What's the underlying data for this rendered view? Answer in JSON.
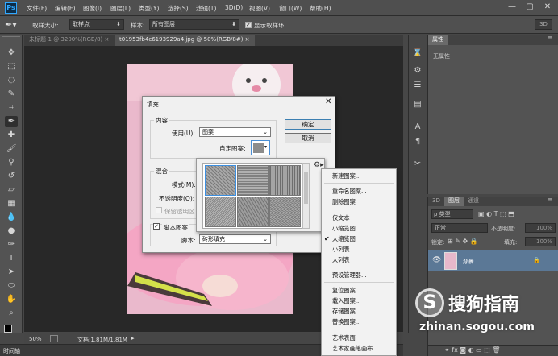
{
  "menubar": {
    "logo": "Ps",
    "items": [
      "文件(F)",
      "编辑(E)",
      "图像(I)",
      "图层(L)",
      "类型(Y)",
      "选择(S)",
      "滤镜(T)",
      "3D(D)",
      "视图(V)",
      "窗口(W)",
      "帮助(H)"
    ],
    "win_min": "—",
    "win_max": "▢",
    "win_close": "✕"
  },
  "options": {
    "sample_size_label": "取样大小:",
    "sample_size_value": "取样点",
    "sample_label": "样本:",
    "sample_value": "所有图层",
    "show_ring_label": "显示取样环",
    "mode_3d": "3D"
  },
  "tabs": [
    {
      "label": "未标题-1 @ 3200%(RGB/8) ×"
    },
    {
      "label": "t01953fb4c6193929a4.jpg @ 50%(RGB/8#) ×"
    }
  ],
  "status": {
    "zoom": "50%",
    "doc": "文档:1.81M/1.81M"
  },
  "timeline": "时间轴",
  "properties": {
    "tab": "属性",
    "empty": "无属性"
  },
  "layers": {
    "tabs": [
      "3D",
      "图层",
      "通道"
    ],
    "kind": "ρ 类型",
    "blend": "正常",
    "opacity_label": "不透明度:",
    "opacity_value": "100%",
    "lock_label": "锁定:",
    "fill_label": "填充:",
    "fill_value": "100%",
    "layer_name": "背景"
  },
  "fill_dialog": {
    "title": "填充",
    "close": "✕",
    "content_group": "内容",
    "use_label": "使用(U):",
    "use_value": "图案",
    "custom_pattern_label": "自定图案:",
    "ok": "确定",
    "cancel": "取消",
    "blend_group": "混合",
    "mode_label": "模式(M):",
    "opacity_label": "不透明度(O):",
    "preserve_label": "保留透明区",
    "script_check_label": "脚本图案",
    "script_label": "脚本:",
    "script_value": "砖形填充"
  },
  "context_menu": {
    "items": [
      "新建图案...",
      "重命名图案...",
      "删除图案",
      "仅文本",
      "小缩览图",
      "大缩览图",
      "小列表",
      "大列表",
      "预设管理器...",
      "复位图案...",
      "载入图案...",
      "存储图案...",
      "替换图案...",
      "艺术表面",
      "艺术家画笔画布"
    ],
    "checked_item": "大缩览图"
  },
  "watermark": {
    "logo": "S",
    "text": "搜狗指南",
    "url": "zhinan.sogou.com"
  },
  "colors": {
    "photo_pink": "#e7b8cb",
    "selection": "#31a8ff",
    "layer_selected": "#5b7896"
  }
}
